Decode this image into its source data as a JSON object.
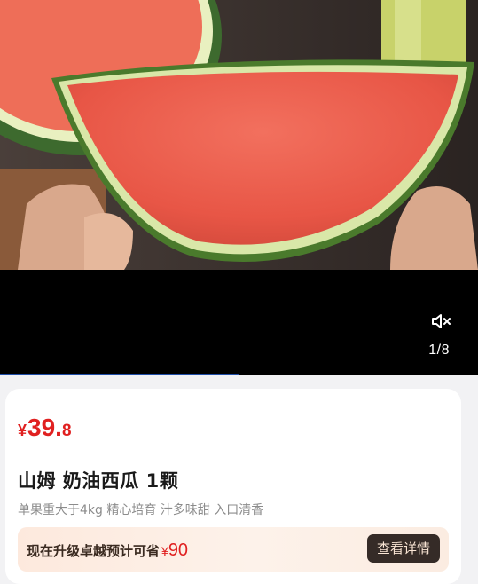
{
  "media": {
    "counter": "1/8",
    "mute_icon": "speaker-muted-icon"
  },
  "product": {
    "price_symbol": "¥",
    "price_int": "39.",
    "price_dec": "8",
    "title": "山姆 奶油西瓜 1颗",
    "subtitle": "单果重大于4kg 精心培育 汁多味甜 入口清香"
  },
  "promo": {
    "text": "现在升级卓越预计可省",
    "amount_symbol": "¥",
    "amount": "90",
    "button_label": "查看详情"
  },
  "colors": {
    "price": "#e02020",
    "promo_button_bg": "#352b27",
    "promo_bg": "#fde9dd"
  }
}
